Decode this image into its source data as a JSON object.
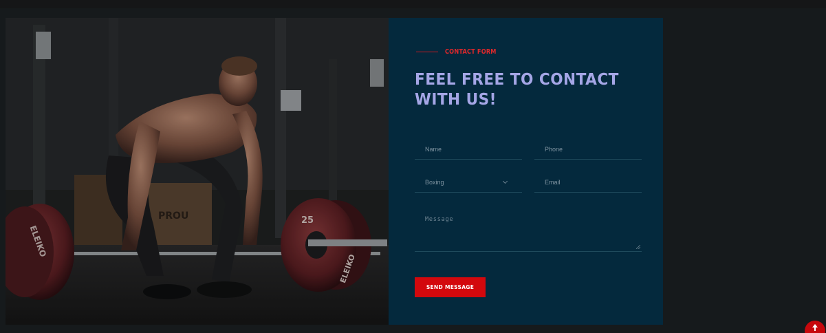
{
  "contact": {
    "eyebrow": "CONTACT FORM",
    "headline": "FEEL FREE TO CONTACT WITH US!",
    "fields": {
      "name_placeholder": "Name",
      "phone_placeholder": "Phone",
      "service_selected": "Boxing",
      "email_placeholder": "Email",
      "message_placeholder": "Message"
    },
    "submit_label": "SEND MESSAGE"
  },
  "photo": {
    "plate_text_left": "ELEIKO",
    "plate_text_right": "ELEIKO",
    "plate_weight": "25",
    "box_text": "PROU"
  },
  "colors": {
    "panel_bg": "#04293d",
    "accent_red": "#d3080d",
    "headline": "#a5a6e6",
    "page_bg": "#161a1c"
  },
  "icons": {
    "scroll_top": "arrow-up-icon",
    "select": "chevron-down-icon"
  }
}
